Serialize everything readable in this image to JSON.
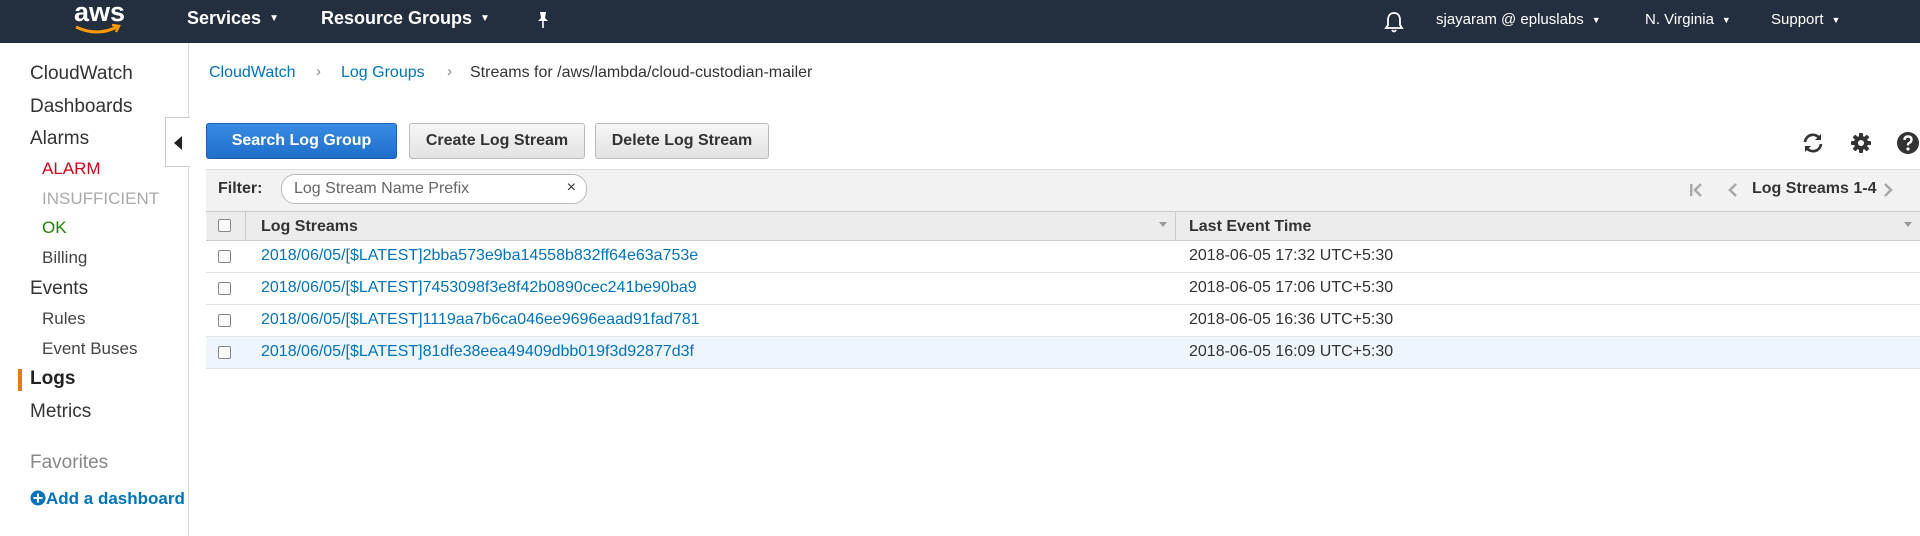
{
  "topnav": {
    "logo_text": "aws",
    "services_label": "Services",
    "resource_groups_label": "Resource Groups",
    "user_label": "sjayaram @ epluslabs",
    "region_label": "N. Virginia",
    "support_label": "Support"
  },
  "sidebar": {
    "items": {
      "cloudwatch": "CloudWatch",
      "dashboards": "Dashboards",
      "alarms": "Alarms",
      "alarm": "ALARM",
      "insufficient": "INSUFFICIENT",
      "ok": "OK",
      "billing": "Billing",
      "events": "Events",
      "rules": "Rules",
      "event_buses": "Event Buses",
      "logs": "Logs",
      "metrics": "Metrics"
    },
    "favorites_heading": "Favorites",
    "add_dashboard_label": "Add a dashboard",
    "colors": {
      "alarm": "#d0021b",
      "insufficient": "#aaaaaa",
      "ok": "#1d8102",
      "active_bar": "#e47911"
    }
  },
  "breadcrumb": {
    "root": "CloudWatch",
    "log_groups": "Log Groups",
    "current": "Streams for /aws/lambda/cloud-custodian-mailer"
  },
  "toolbar": {
    "search_log_group": "Search Log Group",
    "create_log_stream": "Create Log Stream",
    "delete_log_stream": "Delete Log Stream"
  },
  "filter": {
    "label": "Filter:",
    "placeholder": "Log Stream Name Prefix",
    "value": "",
    "clear_glyph": "×",
    "pager_label": "Log Streams 1-4"
  },
  "table": {
    "headers": {
      "streams": "Log Streams",
      "last_event": "Last Event Time"
    },
    "rows": [
      {
        "stream": "2018/06/05/[$LATEST]2bba573e9ba14558b832ff64e63a753e",
        "time": "2018-06-05 17:32 UTC+5:30"
      },
      {
        "stream": "2018/06/05/[$LATEST]7453098f3e8f42b0890cec241be90ba9",
        "time": "2018-06-05 17:06 UTC+5:30"
      },
      {
        "stream": "2018/06/05/[$LATEST]1119aa7b6ca046ee9696eaad91fad781",
        "time": "2018-06-05 16:36 UTC+5:30"
      },
      {
        "stream": "2018/06/05/[$LATEST]81dfe38eea49409dbb019f3d92877d3f",
        "time": "2018-06-05 16:09 UTC+5:30"
      }
    ]
  }
}
